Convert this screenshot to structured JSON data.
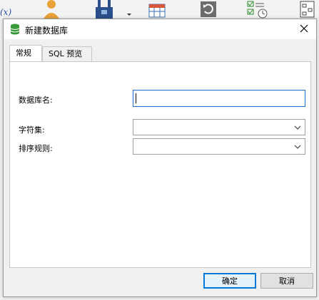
{
  "background_toolbar": {
    "fx_label": "(x)",
    "icons": [
      "user-icon",
      "plug-icon",
      "table-grid-icon",
      "restore-icon",
      "schedule-icon",
      "model-icon"
    ]
  },
  "dialog": {
    "title": "新建数据库",
    "title_icon": "database-icon",
    "close_icon": "close-icon",
    "tabs": [
      {
        "label": "常规",
        "active": true
      },
      {
        "label": "SQL 预览",
        "active": false
      }
    ],
    "fields": {
      "database_name": {
        "label": "数据库名:",
        "value": ""
      },
      "charset": {
        "label": "字符集:",
        "value": ""
      },
      "collation": {
        "label": "排序规则:",
        "value": ""
      }
    },
    "buttons": {
      "ok": "确定",
      "cancel": "取消"
    }
  },
  "colors": {
    "accent": "#0078d7",
    "focus_border": "#1f6fd0",
    "db_icon_green": "#3a9a3a"
  }
}
